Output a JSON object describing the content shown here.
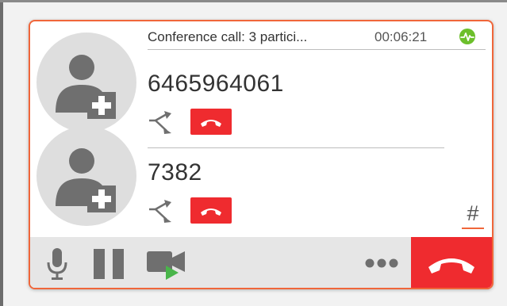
{
  "conference": {
    "title": "Conference call: 3 partici...",
    "duration": "00:06:21",
    "status_icon": "activity-pulse-icon"
  },
  "participants": [
    {
      "number": "6465964061",
      "avatar_icon": "add-contact-icon"
    },
    {
      "number": "7382",
      "avatar_icon": "add-contact-icon"
    }
  ],
  "dialpad": {
    "label": "#"
  },
  "colors": {
    "accent": "#f0663a",
    "hangup": "#ef2b2f",
    "status_green": "#6cbf2b",
    "play_green": "#49b54a",
    "icon_gray": "#6f6f6f"
  },
  "toolbar": {
    "icons": [
      "microphone-icon",
      "pause-icon",
      "video-camera-icon",
      "more-icon",
      "hangup-icon"
    ]
  }
}
